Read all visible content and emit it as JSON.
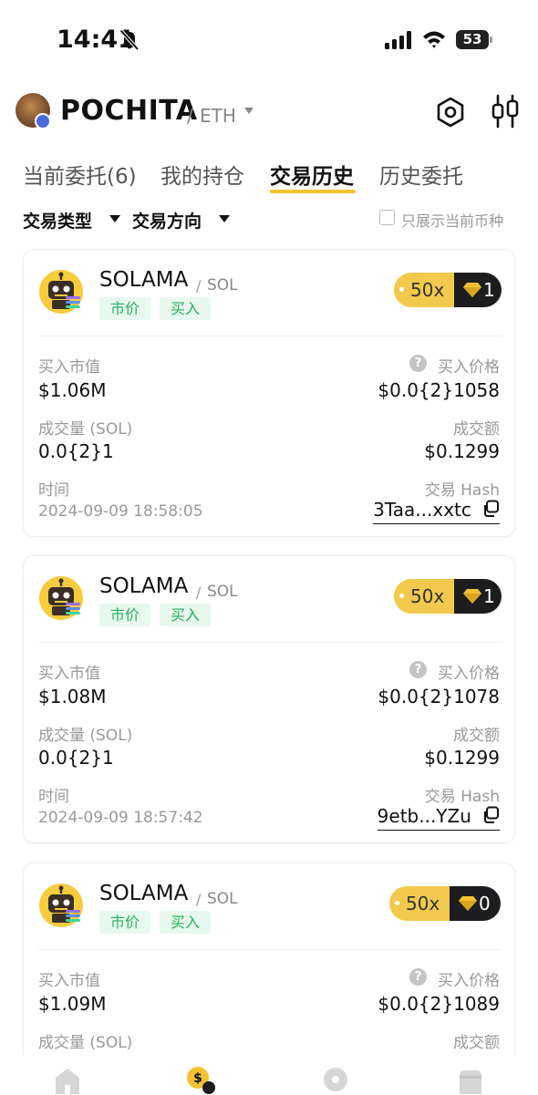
{
  "status_bar": {
    "time": "14:41",
    "battery": "53"
  },
  "header": {
    "title": "POCHITA",
    "separator": "/",
    "chain": "ETH"
  },
  "tabs": [
    {
      "label": "当前委托(6)",
      "active": false
    },
    {
      "label": "我的持仓",
      "active": false
    },
    {
      "label": "交易历史",
      "active": true
    },
    {
      "label": "历史委托",
      "active": false
    }
  ],
  "filters": {
    "trade_type": "交易类型",
    "trade_direction": "交易方向",
    "only_current": "只展示当前币种"
  },
  "labels": {
    "market_value": "买入市值",
    "buy_price": "买入价格",
    "volume": "成交量 (SOL)",
    "amount": "成交额",
    "time": "时间",
    "tx_hash": "交易 Hash",
    "help": "?"
  },
  "trades": [
    {
      "token": "SOLAMA",
      "sep": "/",
      "chain": "SOL",
      "tag_type": "市价",
      "tag_side": "买入",
      "leverage": "50x",
      "gems": "1",
      "market_value": "$1.06M",
      "buy_price": "$0.0{2}1058",
      "volume": "0.0{2}1",
      "amount": "$0.1299",
      "time": "2024-09-09 18:58:05",
      "hash": "3Taa...xxtc"
    },
    {
      "token": "SOLAMA",
      "sep": "/",
      "chain": "SOL",
      "tag_type": "市价",
      "tag_side": "买入",
      "leverage": "50x",
      "gems": "1",
      "market_value": "$1.08M",
      "buy_price": "$0.0{2}1078",
      "volume": "0.0{2}1",
      "amount": "$0.1299",
      "time": "2024-09-09 18:57:42",
      "hash": "9etb...YZu"
    },
    {
      "token": "SOLAMA",
      "sep": "/",
      "chain": "SOL",
      "tag_type": "市价",
      "tag_side": "买入",
      "leverage": "50x",
      "gems": "0",
      "market_value": "$1.09M",
      "buy_price": "$0.0{2}1089",
      "volume": "",
      "amount": "",
      "time": "",
      "hash": ""
    }
  ],
  "colors": {
    "accent": "#f3c130",
    "tag_bg": "#e8f8ee",
    "tag_text": "#23b15b",
    "dark_pill": "#1d1d1f"
  },
  "icons": [
    "bell-off-icon",
    "signal-icon",
    "wifi-icon",
    "settings-hex-icon",
    "filter-sliders-icon",
    "robot-token-icon",
    "gem-icon",
    "copy-icon",
    "home-icon",
    "trade-icon",
    "discover-icon",
    "wallet-icon"
  ]
}
